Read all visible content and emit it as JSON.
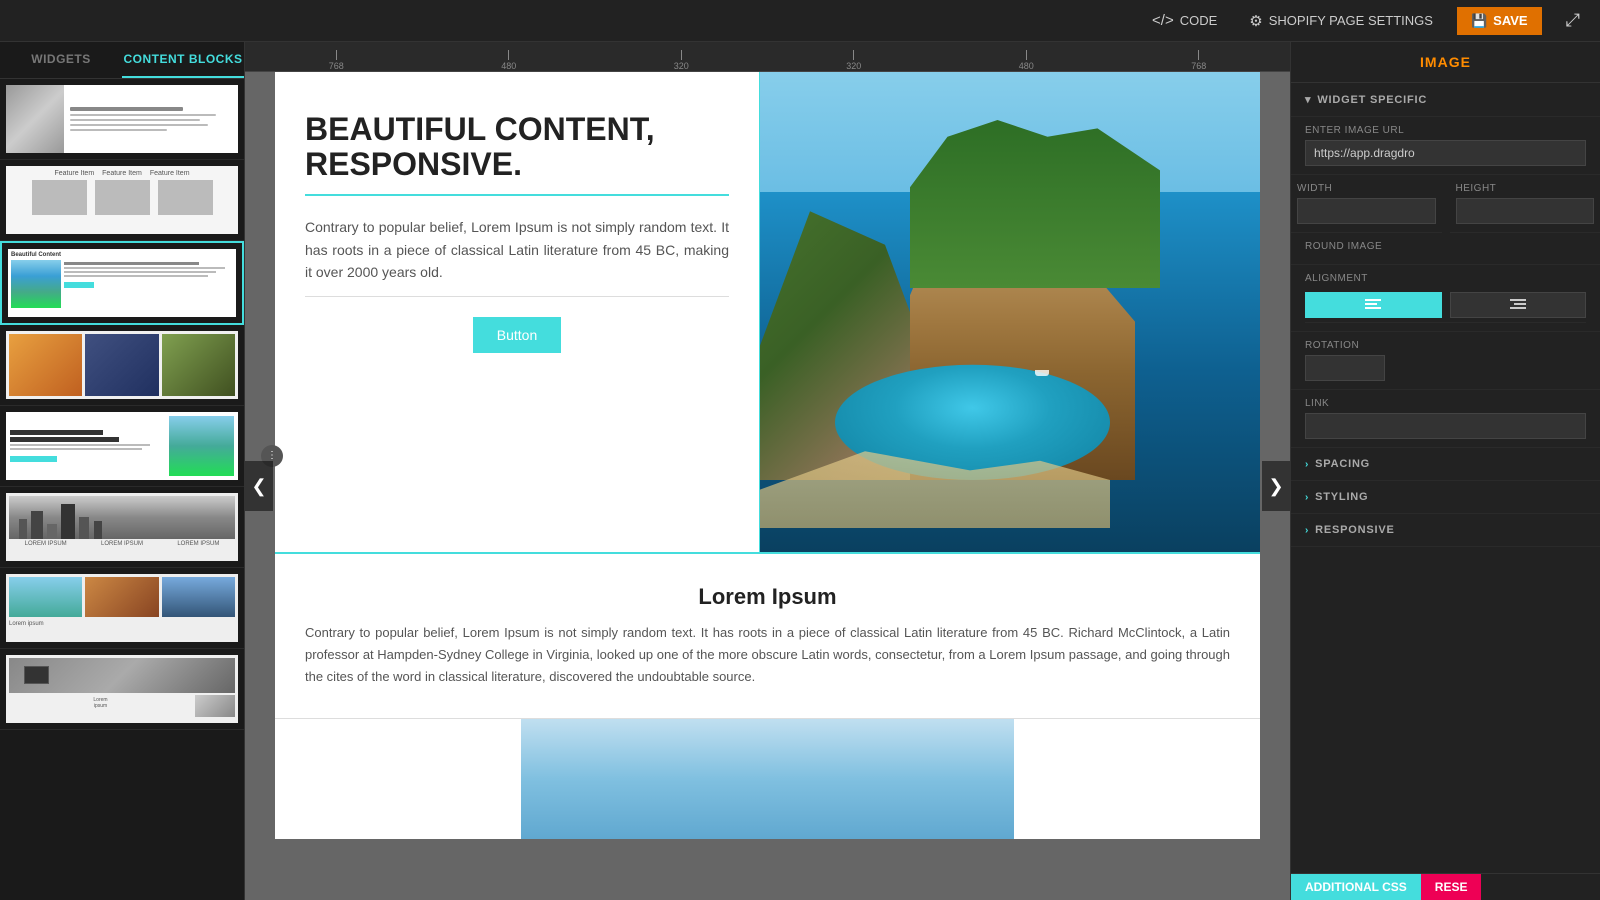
{
  "toolbar": {
    "code_label": "CODE",
    "settings_label": "SHOPIFY PAGE SETTINGS",
    "save_label": "SAVE",
    "expand_icon": "⤢"
  },
  "left_panel": {
    "tab_widgets": "WIDGETS",
    "tab_content_blocks": "CONTENT BLOCKS",
    "active_tab": "CONTENT BLOCKS"
  },
  "ruler": {
    "marks": [
      "768",
      "480",
      "320",
      "320",
      "480",
      "768"
    ]
  },
  "canvas": {
    "hero": {
      "title": "BEAUTIFUL CONTENT, RESPONSIVE.",
      "body": "Contrary to popular belief, Lorem Ipsum is not simply random text. It has roots in a piece of classical Latin literature from 45 BC, making it over 2000 years old.",
      "button_label": "Button"
    },
    "section2": {
      "heading": "Lorem Ipsum",
      "body": "Contrary to popular belief, Lorem Ipsum is not simply random text. It has roots in a piece of classical Latin literature from 45 BC. Richard McClintock, a Latin professor at Hampden-Sydney College in Virginia, looked up one of the more obscure Latin words, consectetur, from a Lorem Ipsum passage, and going through the cites of the word in classical literature, discovered the undoubtable source."
    }
  },
  "right_panel": {
    "title": "IMAGE",
    "widget_specific_label": "WIDGET SPECIFIC",
    "enter_image_url_label": "ENTER IMAGE URL",
    "image_url_value": "https://app.dragdro",
    "width_label": "WIDTH",
    "height_label": "HEIGHT",
    "round_image_label": "ROUND IMAGE",
    "alignment_label": "ALIGNMENT",
    "rotation_label": "ROTATION",
    "link_label": "LINK",
    "spacing_label": "SPACING",
    "styling_label": "STYLING",
    "responsive_label": "RESPONSIVE"
  },
  "bottom_bar": {
    "additional_css_label": "ADDITIONAL CSS",
    "reset_label": "RESE"
  },
  "icons": {
    "code_icon": "</>",
    "gear_icon": "⚙",
    "save_icon": "💾",
    "arrow_left": "❮",
    "arrow_right": "❯",
    "drag_dots": "⋮",
    "chevron_right": "›",
    "chevron_down": "▾",
    "align_left": "≡",
    "align_right": "≡"
  }
}
